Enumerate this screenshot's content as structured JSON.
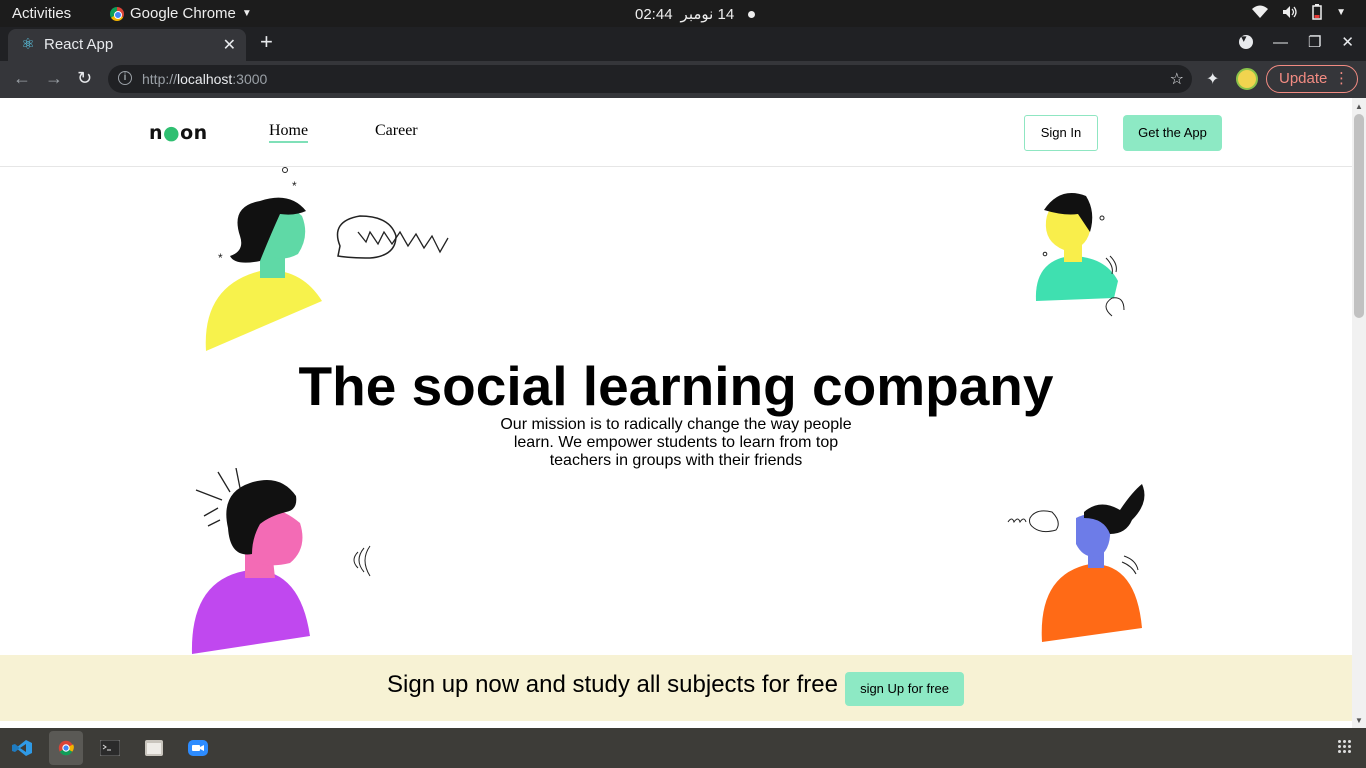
{
  "system": {
    "activities": "Activities",
    "app_menu": "Google Chrome",
    "clock_time": "02:44",
    "clock_date": "14 نومبر"
  },
  "browser": {
    "tab_title": "React App",
    "url_scheme": "http://",
    "url_host": "localhost",
    "url_port": ":3000",
    "update_label": "Update"
  },
  "nav": {
    "logo": "neon",
    "links": [
      {
        "label": "Home",
        "active": true
      },
      {
        "label": "Career",
        "active": false
      }
    ],
    "signin_label": "Sign In",
    "getapp_label": "Get the App"
  },
  "hero": {
    "headline": "The social learning company",
    "mission": "Our mission is to radically change the way people learn. We empower students to learn from top teachers in groups with their friends"
  },
  "signup": {
    "text": "Sign up now and study all subjects for free",
    "button_label": "sign Up for free"
  },
  "colors": {
    "accent": "#8de9c4",
    "band": "#f7f2d4",
    "logo_dot": "#2fbf71"
  },
  "dock": {
    "apps": [
      "vscode-icon",
      "chrome-icon",
      "terminal-icon",
      "files-icon",
      "zoom-icon"
    ]
  }
}
